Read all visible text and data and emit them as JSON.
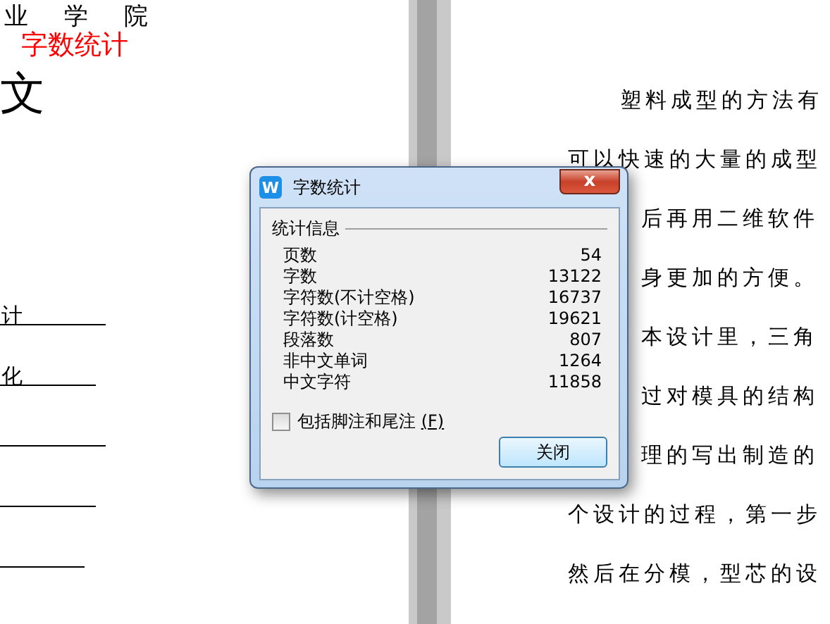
{
  "left_page": {
    "heading_top": "业 学 院",
    "stamp": "字数统计",
    "heading": "文",
    "fields": [
      {
        "text": "计"
      },
      {
        "text": "化"
      }
    ]
  },
  "right_page": {
    "lines": [
      {
        "kind": "indent",
        "text": "塑料成型的方法有"
      },
      {
        "kind": "plain",
        "text": "可以快速的大量的成型"
      },
      {
        "kind": "partial",
        "text": "后再用二维软件"
      },
      {
        "kind": "partial",
        "text": "身更加的方便。"
      },
      {
        "kind": "partial",
        "text": "本设计里，三角"
      },
      {
        "kind": "partial",
        "text": "过对模具的结构"
      },
      {
        "kind": "partial",
        "text": "理的写出制造的"
      },
      {
        "kind": "plain",
        "text": "个设计的过程，第一步"
      },
      {
        "kind": "plain",
        "text": "然后在分模，型芯的设"
      }
    ]
  },
  "dialog": {
    "app_icon": "W",
    "title": "字数统计",
    "close": "x",
    "group": "统计信息",
    "rows": [
      {
        "label": "页数",
        "value": "54"
      },
      {
        "label": "字数",
        "value": "13122"
      },
      {
        "label": "字符数(不计空格)",
        "value": "16737"
      },
      {
        "label": "字符数(计空格)",
        "value": "19621"
      },
      {
        "label": "段落数",
        "value": "807"
      },
      {
        "label": "非中文单词",
        "value": "1264"
      },
      {
        "label": "中文字符",
        "value": "11858"
      }
    ],
    "checkbox": {
      "label": "包括脚注和尾注",
      "shortcut": "(F)",
      "checked": false
    },
    "button": "关闭"
  }
}
